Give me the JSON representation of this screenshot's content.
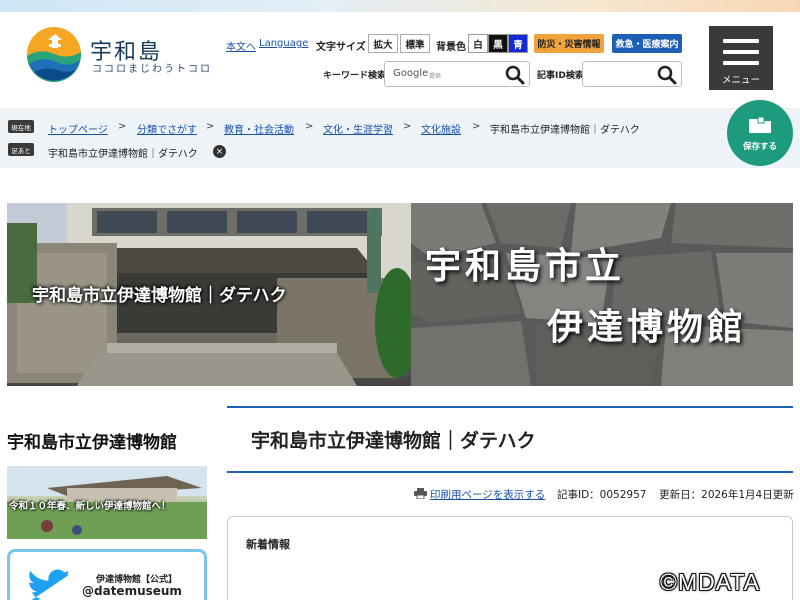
{
  "site": {
    "name": "宇和島",
    "tagline": "ココロまじわうトコロ"
  },
  "header": {
    "skip_link": "本文へ",
    "language_link": "Language",
    "font_size_label": "文字サイズ",
    "font_enlarge": "拡大",
    "font_standard": "標準",
    "bg_color_label": "背景色",
    "bg_white": "白",
    "bg_black": "黒",
    "bg_blue": "青",
    "disaster_info": "防災・災害情報",
    "emergency_medical": "救急・医療案内",
    "keyword_search_label": "キーワード検索",
    "google_brand": "Google",
    "google_provided": "提供",
    "article_id_search_label": "記事ID検索",
    "menu_label": "メニュー"
  },
  "breadcrumb": {
    "current_tag": "現在地",
    "items": [
      "トップページ",
      "分類でさがす",
      "教育・社会活動",
      "文化・生涯学習",
      "文化施設"
    ],
    "separator": ">",
    "current": "宇和島市立伊達博物館｜ダテハク"
  },
  "footprint": {
    "tag": "足あと",
    "item": "宇和島市立伊達博物館｜ダテハク",
    "close": "×"
  },
  "save_button": {
    "label": "保存する"
  },
  "hero": {
    "title": "宇和島市立伊達博物館｜ダテハク",
    "calligraphy_line1": "宇和島市立",
    "calligraphy_line2": "伊達博物館"
  },
  "sidebar": {
    "logo_text": "宇和島市立伊達博物館",
    "banner_text": "令和１０年春、新しい伊達博物館へ！",
    "twitter_name": "伊達博物館【公式】",
    "twitter_handle": "@datemuseum"
  },
  "main": {
    "title": "宇和島市立伊達博物館｜ダテハク",
    "print_link": "印刷用ページを表示する",
    "article_id": "記事ID：0052957",
    "updated": "更新日：2026年1月4日更新",
    "news_heading": "新着情報"
  },
  "watermark": "©MDATA",
  "colors": {
    "accent_blue": "#1d5fb6",
    "disaster_orange": "#f0a23c",
    "save_green": "#1e9a7e",
    "menu_dark": "#3a3a3a",
    "link_blue": "#1a52a8"
  }
}
